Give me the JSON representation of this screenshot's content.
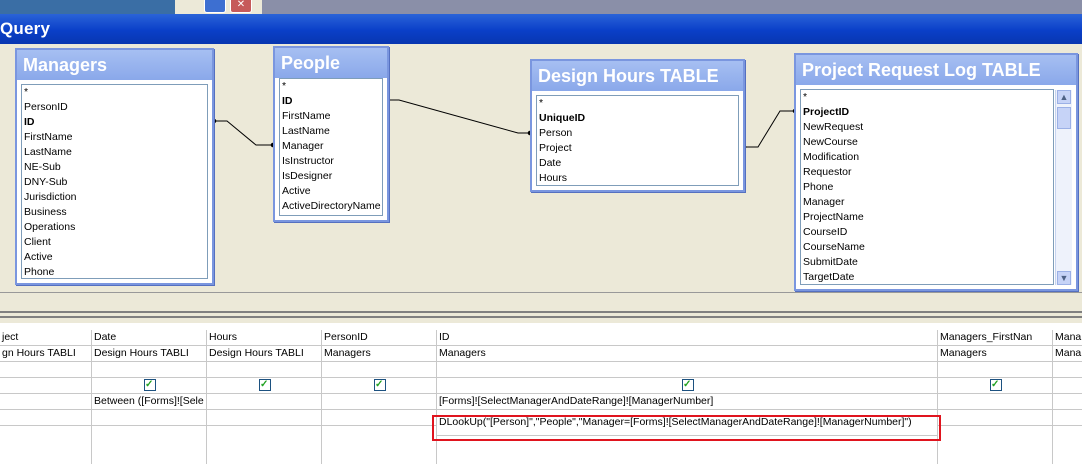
{
  "window": {
    "title": "Query"
  },
  "tables": [
    {
      "name": "Managers",
      "fields": [
        {
          "label": "*",
          "key": false
        },
        {
          "label": "PersonID",
          "key": false
        },
        {
          "label": "ID",
          "key": true
        },
        {
          "label": "FirstName",
          "key": false
        },
        {
          "label": "LastName",
          "key": false
        },
        {
          "label": "NE-Sub",
          "key": false
        },
        {
          "label": "DNY-Sub",
          "key": false
        },
        {
          "label": "Jurisdiction",
          "key": false
        },
        {
          "label": "Business",
          "key": false
        },
        {
          "label": "Operations",
          "key": false
        },
        {
          "label": "Client",
          "key": false
        },
        {
          "label": "Active",
          "key": false
        },
        {
          "label": "Phone",
          "key": false
        }
      ]
    },
    {
      "name": "People",
      "fields": [
        {
          "label": "*",
          "key": false
        },
        {
          "label": "ID",
          "key": true
        },
        {
          "label": "FirstName",
          "key": false
        },
        {
          "label": "LastName",
          "key": false
        },
        {
          "label": "Manager",
          "key": false
        },
        {
          "label": "IsInstructor",
          "key": false
        },
        {
          "label": "IsDesigner",
          "key": false
        },
        {
          "label": "Active",
          "key": false
        },
        {
          "label": "ActiveDirectoryName",
          "key": false
        }
      ]
    },
    {
      "name": "Design Hours TABLE",
      "fields": [
        {
          "label": "*",
          "key": false
        },
        {
          "label": "UniqueID",
          "key": true
        },
        {
          "label": "Person",
          "key": false
        },
        {
          "label": "Project",
          "key": false
        },
        {
          "label": "Date",
          "key": false
        },
        {
          "label": "Hours",
          "key": false
        }
      ]
    },
    {
      "name": "Project Request Log TABLE",
      "fields": [
        {
          "label": "*",
          "key": false
        },
        {
          "label": "ProjectID",
          "key": true
        },
        {
          "label": "NewRequest",
          "key": false
        },
        {
          "label": "NewCourse",
          "key": false
        },
        {
          "label": "Modification",
          "key": false
        },
        {
          "label": "Requestor",
          "key": false
        },
        {
          "label": "Phone",
          "key": false
        },
        {
          "label": "Manager",
          "key": false
        },
        {
          "label": "ProjectName",
          "key": false
        },
        {
          "label": "CourseID",
          "key": false
        },
        {
          "label": "CourseName",
          "key": false
        },
        {
          "label": "SubmitDate",
          "key": false
        },
        {
          "label": "TargetDate",
          "key": false
        }
      ]
    }
  ],
  "grid": {
    "columns": [
      {
        "field": "ject",
        "table": "gn Hours TABLI",
        "show": false,
        "criteria": "",
        "or": ""
      },
      {
        "field": "Date",
        "table": "Design Hours TABLI",
        "show": true,
        "criteria": "Between ([Forms]![Sele",
        "or": ""
      },
      {
        "field": "Hours",
        "table": "Design Hours TABLI",
        "show": true,
        "criteria": "",
        "or": ""
      },
      {
        "field": "PersonID",
        "table": "Managers",
        "show": true,
        "criteria": "",
        "or": ""
      },
      {
        "field": "ID",
        "table": "Managers",
        "show": true,
        "criteria": "[Forms]![SelectManagerAndDateRange]![ManagerNumber]",
        "or": "DLookUp(\"[Person]\",\"People\",\"Manager=[Forms]![SelectManagerAndDateRange]![ManagerNumber]\")"
      },
      {
        "field": "Managers_FirstNan",
        "table": "Managers",
        "show": true,
        "criteria": "",
        "or": ""
      },
      {
        "field": "Mana",
        "table": "Mana",
        "show": false,
        "criteria": "",
        "or": ""
      }
    ]
  },
  "colors": {
    "title_bar": "#0a3fc8",
    "table_header": "#8aa8ea",
    "highlight": "#e0141e",
    "check": "#21a121"
  },
  "icons": [
    "restore-icon",
    "close-icon",
    "checkbox-checked-icon",
    "scroll-up-icon",
    "scroll-down-icon"
  ]
}
